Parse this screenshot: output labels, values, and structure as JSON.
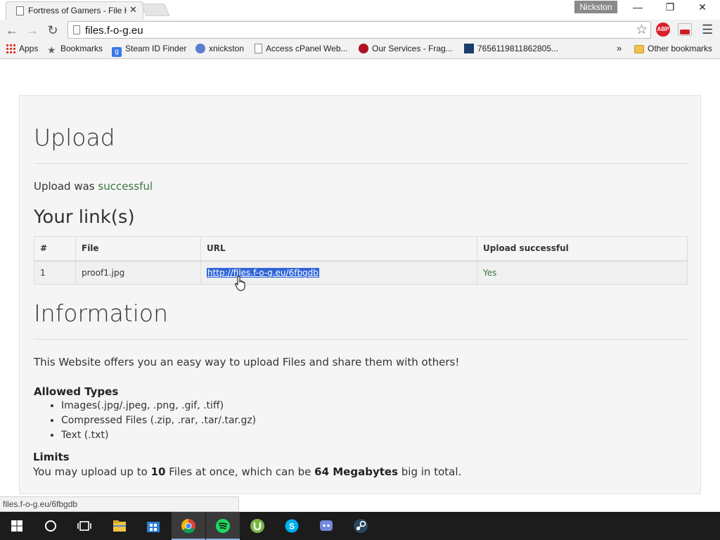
{
  "browser": {
    "tab_title": "Fortress of Gamers - File H",
    "tab_close": "✕",
    "profile_name": "Nickston",
    "window_controls": [
      "—",
      "❐",
      "✕"
    ],
    "address": "files.f-o-g.eu",
    "status_url": "files.f-o-g.eu/6fbgdb",
    "extensions": [
      {
        "name": "adblock-plus",
        "label": "ABP"
      },
      {
        "name": "youtube",
        "label": "You Tube"
      }
    ],
    "bookmarks": [
      {
        "label": "Apps",
        "icon": "apps-grid-icon"
      },
      {
        "label": "Bookmarks",
        "icon": "star-icon"
      },
      {
        "label": "Steam ID Finder",
        "icon": "steam-id-icon"
      },
      {
        "label": "xnickston",
        "icon": "globe-icon"
      },
      {
        "label": "Access cPanel Web...",
        "icon": "page-icon"
      },
      {
        "label": "Our Services - Frag...",
        "icon": "frag-icon"
      },
      {
        "label": "7656119811862805...",
        "icon": "v-icon"
      }
    ],
    "bookmarks_overflow": "»",
    "other_bookmarks": "Other bookmarks"
  },
  "page": {
    "upload_heading": "Upload",
    "upload_status_prefix": "Upload was",
    "upload_status_word": "successful",
    "links_heading": "Your link(s)",
    "table": {
      "headers": [
        "#",
        "File",
        "URL",
        "Upload successful"
      ],
      "rows": [
        {
          "num": "1",
          "file": "proof1.jpg",
          "url": "http://files.f-o-g.eu/6fbgdb",
          "ok": "Yes"
        }
      ]
    },
    "info_heading": "Information",
    "info_text": "This Website offers you an easy way to upload Files and share them with others!",
    "allowed_heading": "Allowed Types",
    "allowed_types": [
      "Images(.jpg/.jpeg, .png, .gif, .tiff)",
      "Compressed Files (.zip, .rar, .tar/.tar.gz)",
      "Text (.txt)"
    ],
    "limits_heading": "Limits",
    "limits_prefix": "You may upload up to",
    "limits_files": "10",
    "limits_middle": "Files at once, which can be",
    "limits_size": "64 Megabytes",
    "limits_suffix": "big in total."
  },
  "taskbar": {
    "items": [
      "windows-start",
      "cortana-search",
      "task-view",
      "file-explorer",
      "store",
      "chrome",
      "spotify",
      "utorrent",
      "skype",
      "discord",
      "steam"
    ],
    "active": "spotify"
  }
}
